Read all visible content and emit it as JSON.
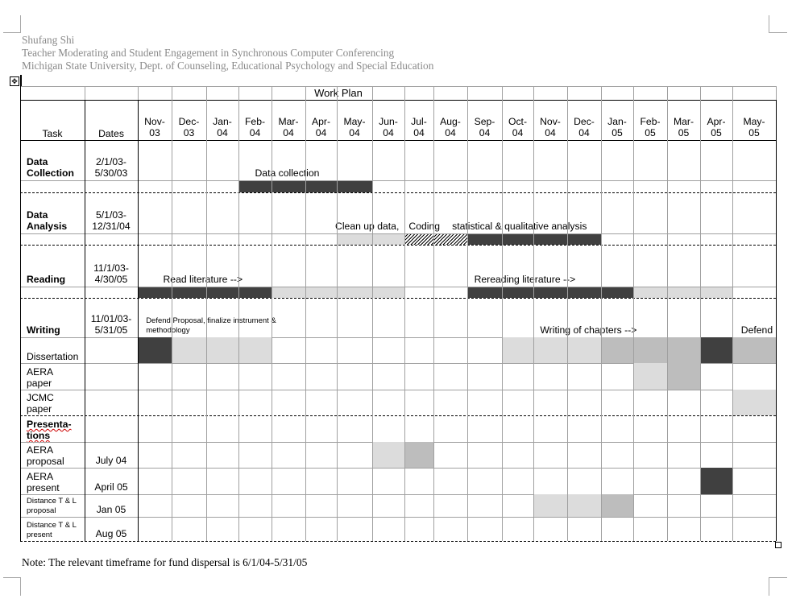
{
  "document_header": {
    "author": "Shufang Shi",
    "title": "Teacher Moderating and Student Engagement in Synchronous Computer Conferencing",
    "affiliation": "Michigan State University, Dept. of Counseling, Educational Psychology and Special Education"
  },
  "table": {
    "title": "Work Plan",
    "col_task": "Task",
    "col_dates": "Dates",
    "months": [
      [
        "Nov-",
        "03"
      ],
      [
        "Dec-",
        "03"
      ],
      [
        "Jan-",
        "04"
      ],
      [
        "Feb-",
        "04"
      ],
      [
        "Mar-",
        "04"
      ],
      [
        "Apr-",
        "04"
      ],
      [
        "May-",
        "04"
      ],
      [
        "Jun-",
        "04"
      ],
      [
        "Jul-",
        "04"
      ],
      [
        "Aug-",
        "04"
      ],
      [
        "Sep-",
        "04"
      ],
      [
        "Oct-",
        "04"
      ],
      [
        "Nov-",
        "04"
      ],
      [
        "Dec-",
        "04"
      ],
      [
        "Jan-",
        "05"
      ],
      [
        "Feb-",
        "05"
      ],
      [
        "Mar-",
        "05"
      ],
      [
        "Apr-",
        "05"
      ],
      [
        "May-",
        "05"
      ]
    ],
    "shade_colors": {
      "dark": "#404040",
      "mid": "#bdbdbd",
      "light": "#dcdcdc",
      "hatch": "hatch"
    },
    "sections": [
      {
        "task": [
          "Data",
          "Collection"
        ],
        "bold": true,
        "dates": [
          "2/1/03-",
          "5/30/03"
        ],
        "annotations": [
          {
            "text": "Data collection",
            "col": 3.5
          }
        ],
        "bar": [
          null,
          null,
          null,
          "dark",
          "dark",
          "dark",
          "dark",
          null,
          null,
          null,
          null,
          null,
          null,
          null,
          null,
          null,
          null,
          null,
          null
        ]
      },
      {
        "task": [
          "Data",
          "Analysis"
        ],
        "bold": true,
        "dates": [
          "5/1/03-",
          "12/31/04"
        ],
        "annotations": [
          {
            "text": "Clean up data,",
            "col": 5.95
          },
          {
            "text": "Coding",
            "col": 8.15
          },
          {
            "text": "statistical & qualitative analysis",
            "col": 9.55
          }
        ],
        "bar": [
          null,
          null,
          null,
          null,
          null,
          null,
          "light",
          "light",
          "hatch",
          "hatch",
          "dark",
          "dark",
          "dark",
          "dark",
          null,
          null,
          null,
          null,
          null
        ]
      },
      {
        "task": [
          "Reading"
        ],
        "bold": true,
        "dates": [
          "11/1/03-",
          "4/30/05"
        ],
        "annotations": [
          {
            "text": "Read literature -->",
            "col": 0.75
          },
          {
            "text": "Rereading literature -->",
            "col": 10.2
          }
        ],
        "bar": [
          "dark",
          "dark",
          "dark",
          "dark",
          "light",
          "light",
          "light",
          "light",
          null,
          null,
          "dark",
          "dark",
          "dark",
          "dark",
          "dark",
          "light",
          "light",
          "light",
          null
        ]
      }
    ],
    "writing": {
      "task": "Writing",
      "dates": [
        "11/01/03-",
        "5/31/05"
      ],
      "annotations": [
        {
          "text": "Defend Proposal, finalize instrument &",
          "line2": "methodology",
          "col": 0.1,
          "small": true
        },
        {
          "text": "Writing of chapters -->",
          "col": 12.2
        },
        {
          "text": "Defend",
          "col": 18.2
        }
      ]
    },
    "rows": [
      {
        "task": [
          "Dissertation"
        ],
        "dates": [],
        "small": false,
        "cells": [
          "dark",
          "light",
          "light",
          "light",
          null,
          null,
          null,
          null,
          null,
          null,
          null,
          "light",
          "light",
          "light",
          "mid",
          "mid",
          "mid",
          "dark",
          "mid"
        ]
      },
      {
        "task": [
          "AERA",
          "paper"
        ],
        "dates": [],
        "small": false,
        "cells": [
          null,
          null,
          null,
          null,
          null,
          null,
          null,
          null,
          null,
          null,
          null,
          null,
          null,
          null,
          null,
          "light",
          "mid",
          null,
          null
        ]
      },
      {
        "task": [
          "JCMC",
          "paper"
        ],
        "dates": [],
        "small": false,
        "cells": [
          null,
          null,
          null,
          null,
          null,
          null,
          null,
          null,
          null,
          null,
          null,
          null,
          null,
          null,
          null,
          null,
          null,
          null,
          "light"
        ]
      },
      {
        "task": [
          "Presenta-",
          "tions"
        ],
        "dates": [],
        "bold": true,
        "cells": [
          null,
          null,
          null,
          null,
          null,
          null,
          null,
          null,
          null,
          null,
          null,
          null,
          null,
          null,
          null,
          null,
          null,
          null,
          null
        ]
      },
      {
        "task": [
          "AERA",
          "proposal"
        ],
        "dates": [
          "July 04"
        ],
        "small": false,
        "cells": [
          null,
          null,
          null,
          null,
          null,
          null,
          null,
          "light",
          "mid",
          null,
          null,
          null,
          null,
          null,
          null,
          null,
          null,
          null,
          null
        ]
      },
      {
        "task": [
          "AERA",
          "present"
        ],
        "dates": [
          "April 05"
        ],
        "small": false,
        "cells": [
          null,
          null,
          null,
          null,
          null,
          null,
          null,
          null,
          null,
          null,
          null,
          null,
          null,
          null,
          null,
          null,
          null,
          "dark",
          null
        ]
      },
      {
        "task": [
          "Distance T & L",
          "proposal"
        ],
        "dates": [
          "Jan 05"
        ],
        "small": true,
        "cells": [
          null,
          null,
          null,
          null,
          null,
          null,
          null,
          null,
          null,
          null,
          null,
          null,
          "light",
          "light",
          "mid",
          null,
          null,
          null,
          null
        ]
      },
      {
        "task": [
          "Distance T & L",
          "present"
        ],
        "dates": [
          "Aug 05"
        ],
        "small": true,
        "cells": [
          null,
          null,
          null,
          null,
          null,
          null,
          null,
          null,
          null,
          null,
          null,
          null,
          null,
          null,
          null,
          null,
          null,
          null,
          null
        ]
      }
    ]
  },
  "footnote": "Note: The relevant timeframe for fund dispersal is 6/1/04-5/31/05"
}
